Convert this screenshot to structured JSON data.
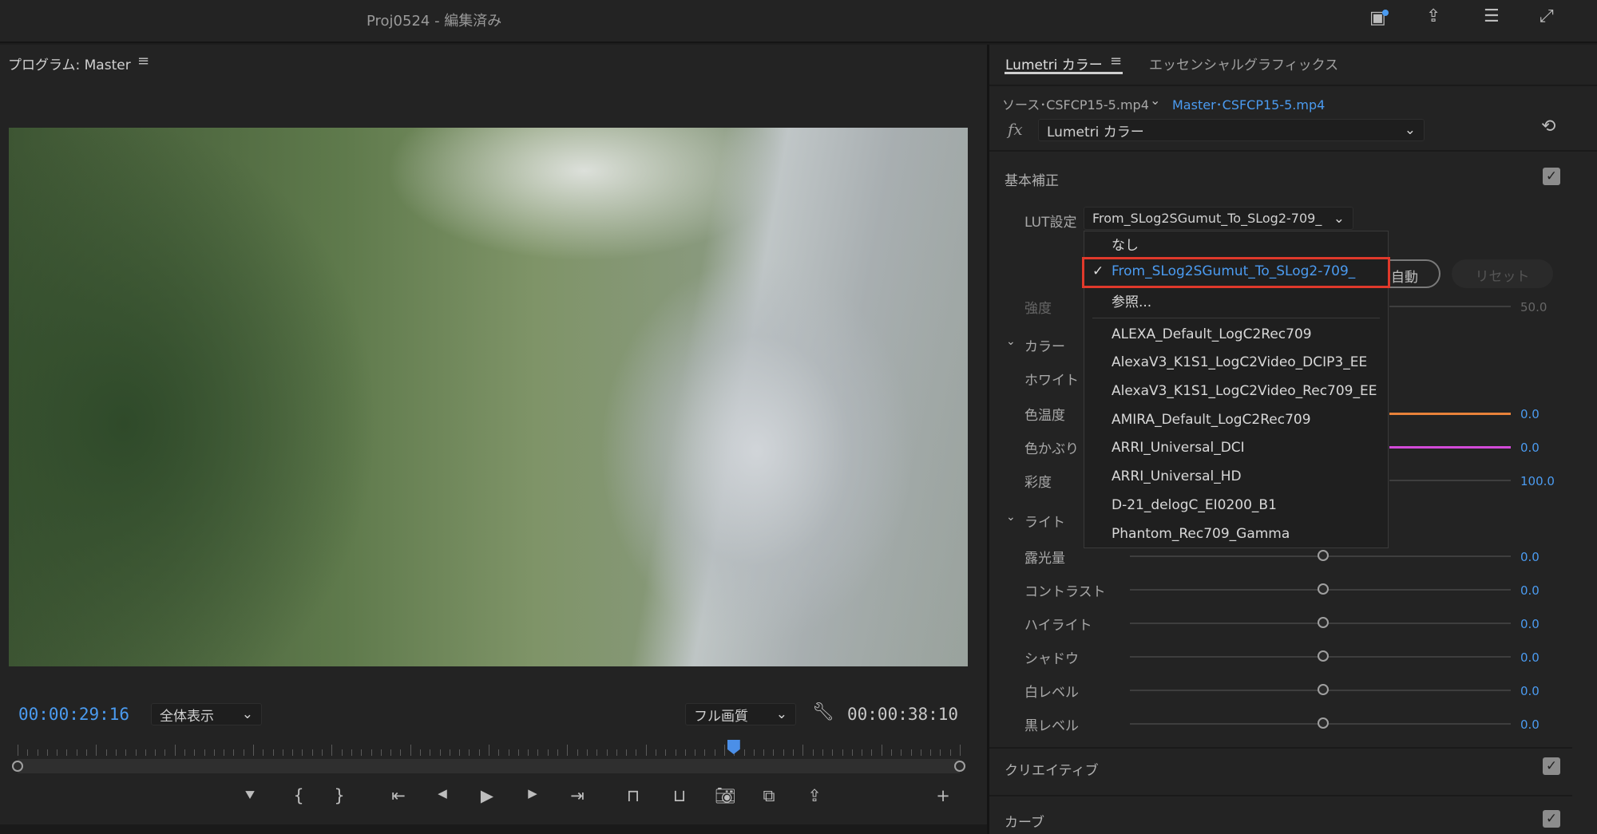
{
  "window": {
    "title": "Proj0524 - 編集済み",
    "icons": [
      "notification-icon",
      "share-icon",
      "workspaces-icon",
      "fullscreen-icon"
    ]
  },
  "program": {
    "title": "プログラム: Master",
    "current_time": "00:00:29:16",
    "zoom": "全体表示",
    "quality": "フル画質",
    "duration": "00:00:38:10",
    "playhead_fraction": 0.76
  },
  "transport": [
    "marker-icon",
    "mark-in-icon",
    "mark-out-icon",
    "go-to-in-icon",
    "step-back-icon",
    "play-icon",
    "step-forward-icon",
    "go-to-out-icon",
    "insert-icon",
    "overwrite-icon",
    "export-frame-icon",
    "compare-icon",
    "share-icon",
    "add-button-icon"
  ],
  "lumetri": {
    "tabs": [
      "Lumetri カラー",
      "エッセンシャルグラフィックス"
    ],
    "source": "ソース･CSFCP15-5.mp4",
    "master": "Master･CSFCP15-5.mp4",
    "fx": "fx",
    "effect": "Lumetri カラー",
    "basic": {
      "title": "基本補正",
      "enabled": true,
      "lut_label": "LUT設定",
      "lut_value": "From_SLog2SGumut_To_SLog2-709_",
      "auto": "自動",
      "reset": "リセット",
      "intensity_label": "強度",
      "intensity": "50.0"
    },
    "color": {
      "title": "カラー",
      "white": "ホワイト",
      "temp_label": "色温度",
      "temp": "0.0",
      "tint_label": "色かぶり",
      "tint": "0.0",
      "sat_label": "彩度",
      "sat": "100.0"
    },
    "light": {
      "title": "ライト",
      "sliders": [
        {
          "label": "露光量",
          "value": "0.0"
        },
        {
          "label": "コントラスト",
          "value": "0.0"
        },
        {
          "label": "ハイライト",
          "value": "0.0"
        },
        {
          "label": "シャドウ",
          "value": "0.0"
        },
        {
          "label": "白レベル",
          "value": "0.0"
        },
        {
          "label": "黒レベル",
          "value": "0.0"
        }
      ]
    },
    "creative": {
      "title": "クリエイティブ",
      "enabled": true
    },
    "curves": {
      "title": "カーブ",
      "enabled": true
    }
  },
  "lut_menu": {
    "items": [
      "なし",
      "From_SLog2SGumut_To_SLog2-709_",
      "参照...",
      "ALEXA_Default_LogC2Rec709",
      "AlexaV3_K1S1_LogC2Video_DCIP3_EE",
      "AlexaV3_K1S1_LogC2Video_Rec709_EE",
      "AMIRA_Default_LogC2Rec709",
      "ARRI_Universal_DCI",
      "ARRI_Universal_HD",
      "D-21_delogC_EI0200_B1",
      "Phantom_Rec709_Gamma"
    ],
    "selected": 1,
    "highlight_color": "#e0392b"
  },
  "colors": {
    "accent": "#4b9bf0",
    "temp_line": "#e8823a",
    "tint_line": "#d24ad8"
  }
}
